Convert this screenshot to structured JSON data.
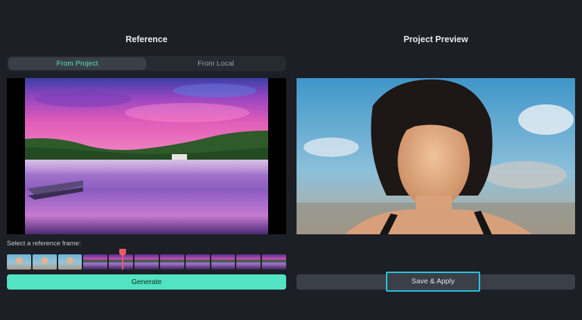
{
  "reference": {
    "title": "Reference",
    "tabs": [
      {
        "label": "From Project",
        "active": true
      },
      {
        "label": "From Local",
        "active": false
      }
    ],
    "frame_label": "Select a reference frame:",
    "generate_label": "Generate"
  },
  "preview": {
    "title": "Project Preview",
    "save_apply_label": "Save & Apply"
  },
  "colors": {
    "accent": "#52e3c2",
    "active_tab_text": "#56e0c4",
    "scrubber": "#f05a67",
    "focus_ring": "#26c8e6",
    "background": "#1c1f25"
  }
}
